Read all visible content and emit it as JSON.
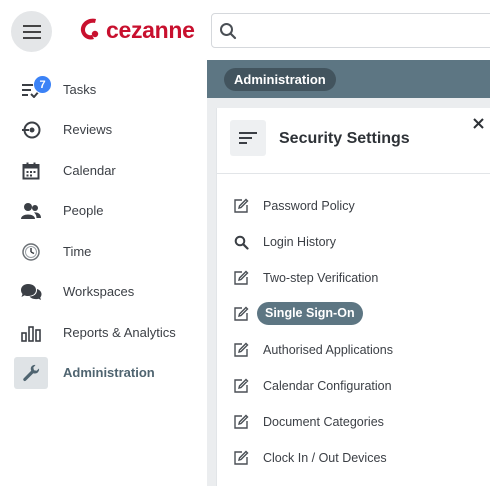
{
  "app": {
    "logo_text": "cezanne",
    "search_placeholder": "",
    "brand_color": "#c8102e",
    "accent_color": "#5d7683"
  },
  "sidebar": {
    "items": [
      {
        "label": "Tasks",
        "icon": "tasks-icon",
        "badge": "7"
      },
      {
        "label": "Reviews",
        "icon": "reviews-icon"
      },
      {
        "label": "Calendar",
        "icon": "calendar-icon"
      },
      {
        "label": "People",
        "icon": "people-icon"
      },
      {
        "label": "Time",
        "icon": "clock-icon"
      },
      {
        "label": "Workspaces",
        "icon": "chat-icon"
      },
      {
        "label": "Reports & Analytics",
        "icon": "bar-chart-icon"
      },
      {
        "label": "Administration",
        "icon": "wrench-icon",
        "active": true
      }
    ]
  },
  "header": {
    "breadcrumb": "Administration"
  },
  "panel": {
    "title": "Security Settings",
    "icon": "list-lines-icon",
    "close_icon": "close-icon",
    "items": [
      {
        "label": "Password Policy",
        "icon": "edit-icon"
      },
      {
        "label": "Login History",
        "icon": "search-icon"
      },
      {
        "label": "Two-step Verification",
        "icon": "edit-icon"
      },
      {
        "label": "Single Sign-On",
        "icon": "edit-icon",
        "selected": true
      },
      {
        "label": "Authorised Applications",
        "icon": "edit-icon"
      },
      {
        "label": "Calendar Configuration",
        "icon": "edit-icon"
      },
      {
        "label": "Document Categories",
        "icon": "edit-icon"
      },
      {
        "label": "Clock In / Out Devices",
        "icon": "edit-icon"
      }
    ]
  }
}
